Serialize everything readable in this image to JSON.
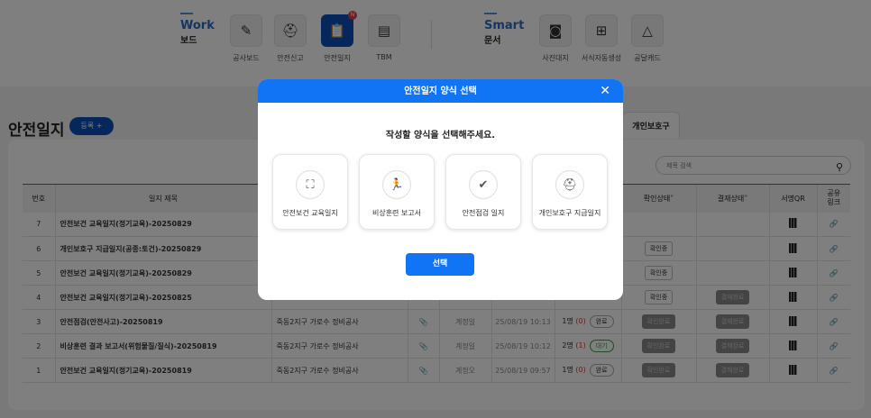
{
  "nav": {
    "work": {
      "en": "Work",
      "ko": "보드"
    },
    "smart": {
      "en": "Smart",
      "ko": "문서"
    },
    "items": [
      {
        "label": "공사보드",
        "icon": "pencil-ruler-icon"
      },
      {
        "label": "안전신고",
        "icon": "hardhat-icon"
      },
      {
        "label": "안전일지",
        "icon": "clipboard-icon",
        "active": true,
        "badge": "N"
      },
      {
        "label": "TBM",
        "icon": "archive-icon"
      },
      {
        "label": "사진대지",
        "icon": "camera-icon"
      },
      {
        "label": "서식자동생성",
        "icon": "doc-add-icon"
      },
      {
        "label": "공달캐드",
        "icon": "triangle-icon"
      }
    ]
  },
  "page": {
    "title": "안전일지",
    "register": "등록 +",
    "tab": "개인보호구",
    "search_placeholder": "제목 검색"
  },
  "table": {
    "headers": {
      "no": "번호",
      "title": "일지 제목",
      "confirm": "확인상태˅",
      "approval": "결재상태˅",
      "qr": "서명QR",
      "link": "공유\n링크"
    },
    "rows": [
      {
        "no": "7",
        "title": "안전보건 교육일지(정기교육)-20250829",
        "site": "",
        "author": "",
        "date": "",
        "signers": "",
        "pending": "",
        "state": "",
        "confirm": "",
        "approval": ""
      },
      {
        "no": "6",
        "title": "개인보호구 지급일지(공종:토건)-20250829",
        "site": "",
        "author": "",
        "date": "",
        "signers": "",
        "pending": "",
        "state": "",
        "confirm": "확인중",
        "approval": ""
      },
      {
        "no": "5",
        "title": "안전보건 교육일지(정기교육)-20250829",
        "site": "",
        "author": "",
        "date": "",
        "signers": "",
        "pending": "",
        "state": "",
        "confirm": "확인중",
        "approval": ""
      },
      {
        "no": "4",
        "title": "안전보건 교육일지(정기교육)-20250825",
        "site": "",
        "author": "",
        "date": "",
        "signers": "",
        "pending": "",
        "state": "",
        "confirm": "확인중",
        "approval": "결재완료"
      },
      {
        "no": "3",
        "title": "안전점검(안전사고)-20250819",
        "site": "죽동2지구 가로수 정비공사",
        "author": "계정일",
        "date": "25/08/19 10:13",
        "signers": "1명",
        "pending": "(0)",
        "state": "완료",
        "confirm": "확인완료",
        "approval": "결재완료"
      },
      {
        "no": "2",
        "title": "비상훈련 결과 보고서(위험물질/질식)-20250819",
        "site": "죽동2지구 가로수 정비공사",
        "author": "계정일",
        "date": "25/08/19 10:12",
        "signers": "2명",
        "pending": "(1)",
        "state": "대기",
        "confirm": "확인완료",
        "approval": "결재완료"
      },
      {
        "no": "1",
        "title": "안전보건 교육일지(정기교육)-20250819",
        "site": "죽동2지구 가로수 정비공사",
        "author": "계정오",
        "date": "25/08/19 09:57",
        "signers": "1명",
        "pending": "(0)",
        "state": "완료",
        "confirm": "확인완료",
        "approval": "결재완료"
      }
    ]
  },
  "modal": {
    "title": "안전일지 양식 선택",
    "prompt": "작성할 양식을 선택해주세요.",
    "options": [
      {
        "label": "안전보건 교육일지",
        "icon": "teaching-icon"
      },
      {
        "label": "비상훈련 보고서",
        "icon": "running-person-icon"
      },
      {
        "label": "안전점검 일지",
        "icon": "clipboard-check-icon"
      },
      {
        "label": "개인보호구 지급일지",
        "icon": "hardhat-icon"
      }
    ],
    "select": "선택"
  }
}
